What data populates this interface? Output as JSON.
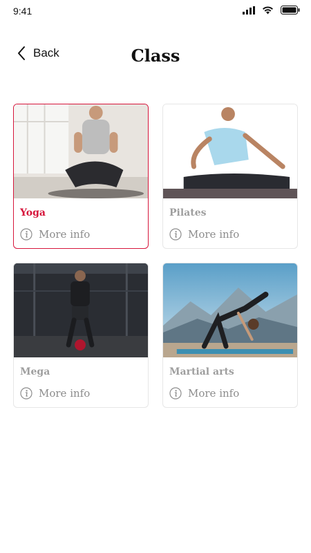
{
  "status_bar": {
    "time": "9:41"
  },
  "header": {
    "back_label": "Back",
    "title": "Class"
  },
  "classes": [
    {
      "name": "Yoga",
      "more_info": "More info",
      "selected": true
    },
    {
      "name": "Pilates",
      "more_info": "More info",
      "selected": false
    },
    {
      "name": "Mega",
      "more_info": "More info",
      "selected": false
    },
    {
      "name": "Martial arts",
      "more_info": "More info",
      "selected": false
    }
  ],
  "colors": {
    "accent": "#d6153b",
    "muted_text": "#9e9e9e",
    "border": "#e6e6e6"
  },
  "icons": [
    "signal-icon",
    "wifi-icon",
    "battery-icon",
    "chevron-left-icon",
    "info-icon"
  ]
}
